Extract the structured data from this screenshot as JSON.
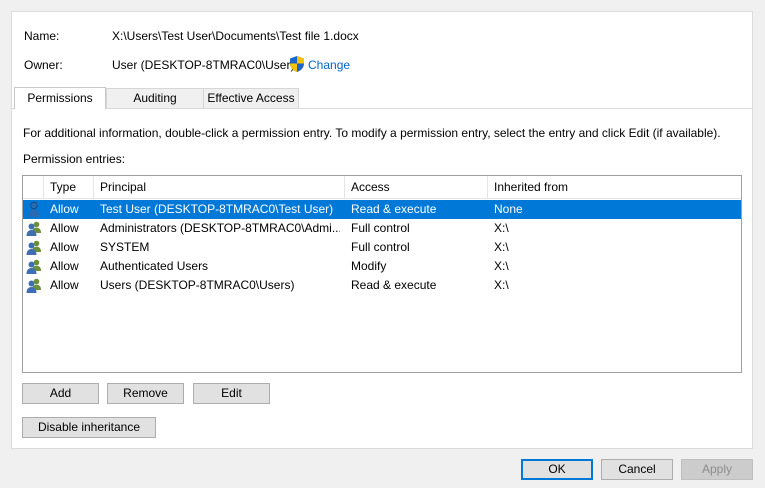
{
  "info": {
    "name_label": "Name:",
    "name_value": "X:\\Users\\Test User\\Documents\\Test file 1.docx",
    "owner_label": "Owner:",
    "owner_value": "User (DESKTOP-8TMRAC0\\User)",
    "change_link": "Change"
  },
  "tabs": [
    {
      "label": "Permissions",
      "active": true
    },
    {
      "label": "Auditing",
      "active": false
    },
    {
      "label": "Effective Access",
      "active": false
    }
  ],
  "instructions": "For additional information, double-click a permission entry. To modify a permission entry, select the entry and click Edit (if available).",
  "entries_label": "Permission entries:",
  "columns": [
    "Type",
    "Principal",
    "Access",
    "Inherited from"
  ],
  "entries": [
    {
      "icon": "single-user-icon",
      "type": "Allow",
      "principal": "Test User (DESKTOP-8TMRAC0\\Test User)",
      "access": "Read & execute",
      "inherited": "None",
      "selected": true
    },
    {
      "icon": "user-group-icon",
      "type": "Allow",
      "principal": "Administrators (DESKTOP-8TMRAC0\\Admi...",
      "access": "Full control",
      "inherited": "X:\\",
      "selected": false
    },
    {
      "icon": "user-group-icon",
      "type": "Allow",
      "principal": "SYSTEM",
      "access": "Full control",
      "inherited": "X:\\",
      "selected": false
    },
    {
      "icon": "user-group-icon",
      "type": "Allow",
      "principal": "Authenticated Users",
      "access": "Modify",
      "inherited": "X:\\",
      "selected": false
    },
    {
      "icon": "user-group-icon",
      "type": "Allow",
      "principal": "Users (DESKTOP-8TMRAC0\\Users)",
      "access": "Read & execute",
      "inherited": "X:\\",
      "selected": false
    }
  ],
  "buttons": {
    "add": "Add",
    "remove": "Remove",
    "edit": "Edit",
    "disable_inheritance": "Disable inheritance",
    "ok": "OK",
    "cancel": "Cancel",
    "apply": "Apply"
  },
  "colors": {
    "selection": "#0078d7",
    "link": "#0066cc",
    "shield_blue": "#1e64c8",
    "shield_yellow": "#f5c400"
  }
}
